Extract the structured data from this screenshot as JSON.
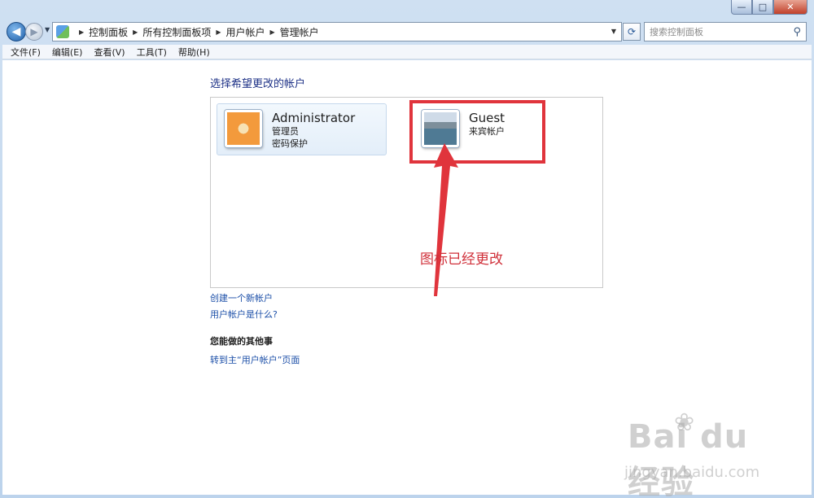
{
  "window": {
    "minimize_glyph": "—",
    "maximize_glyph": "□",
    "close_glyph": "✕"
  },
  "nav": {
    "back_icon": "arrow-left-icon",
    "forward_icon": "arrow-right-icon",
    "breadcrumbs": [
      "控制面板",
      "所有控制面板项",
      "用户帐户",
      "管理帐户"
    ],
    "search_placeholder": "搜索控制面板"
  },
  "menu": {
    "items": [
      "文件(F)",
      "编辑(E)",
      "查看(V)",
      "工具(T)",
      "帮助(H)"
    ]
  },
  "main": {
    "heading": "选择希望更改的帐户",
    "accounts": [
      {
        "name": "Administrator",
        "lines": [
          "管理员",
          "密码保护"
        ],
        "icon": "starfish-avatar"
      },
      {
        "name": "Guest",
        "lines": [
          "来宾帐户"
        ],
        "icon": "lake-avatar"
      }
    ],
    "annotation": "图标已经更改",
    "links": [
      "创建一个新帐户",
      "用户帐户是什么?"
    ],
    "other_heading": "您能做的其他事",
    "other_links": [
      "转到主“用户帐户”页面"
    ]
  },
  "watermark": {
    "logo": "Bai du 经验",
    "url": "jingyan.baidu.com"
  },
  "colors": {
    "annotation": "#d0303a",
    "link": "#1c4fa8",
    "heading": "#1e3287"
  }
}
